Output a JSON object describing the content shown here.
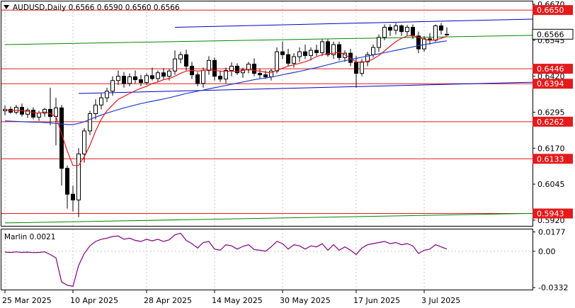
{
  "header": {
    "symbol_text": "AUDUSD,Daily  0.6566 0.6590 0.6560 0.6566"
  },
  "chart_data": {
    "type": "candlestick",
    "symbol": "AUDUSD",
    "timeframe": "Daily",
    "ohlc_header": {
      "open": 0.6566,
      "high": 0.659,
      "low": 0.656,
      "close": 0.6566
    },
    "y_range": [
      0.59,
      0.668
    ],
    "price_ticks": [
      "0.6670",
      "0.6545",
      "0.6420",
      "0.6295",
      "0.6170",
      "0.6045",
      "0.5920"
    ],
    "price_tick_values": [
      0.667,
      0.6545,
      0.642,
      0.6295,
      0.617,
      0.6045,
      0.592
    ],
    "date_labels": [
      "25 Mar 2025",
      "10 Apr 2025",
      "28 Apr 2025",
      "14 May 2025",
      "30 May 2025",
      "17 Jun 2025",
      "3 Jul 2025"
    ],
    "date_label_bar_index": [
      0,
      12,
      25,
      37,
      49,
      62,
      74
    ],
    "current_price": "0.6566",
    "horizontal_levels": [
      {
        "label": "0.6650",
        "value": 0.665,
        "color": "#e41a1c"
      },
      {
        "label": "0.6446",
        "value": 0.6446,
        "color": "#e41a1c"
      },
      {
        "label": "0.6394",
        "value": 0.6394,
        "color": "#e41a1c"
      },
      {
        "label": "0.6262",
        "value": 0.6262,
        "color": "#e41a1c"
      },
      {
        "label": "0.6133",
        "value": 0.6133,
        "color": "#e41a1c"
      },
      {
        "label": "0.5943",
        "value": 0.5943,
        "color": "#e41a1c"
      }
    ],
    "candles": [
      [
        0.63,
        0.6318,
        0.6285,
        0.6305
      ],
      [
        0.6305,
        0.6315,
        0.629,
        0.6295
      ],
      [
        0.6295,
        0.632,
        0.6288,
        0.6312
      ],
      [
        0.6312,
        0.6325,
        0.628,
        0.6288
      ],
      [
        0.6288,
        0.631,
        0.6275,
        0.6302
      ],
      [
        0.6302,
        0.6312,
        0.627,
        0.6278
      ],
      [
        0.6278,
        0.63,
        0.6265,
        0.6292
      ],
      [
        0.6292,
        0.631,
        0.628,
        0.6305
      ],
      [
        0.6305,
        0.638,
        0.625,
        0.628
      ],
      [
        0.628,
        0.6345,
        0.618,
        0.631
      ],
      [
        0.631,
        0.632,
        0.604,
        0.61
      ],
      [
        0.61,
        0.611,
        0.596,
        0.601
      ],
      [
        0.601,
        0.604,
        0.595,
        0.599
      ],
      [
        0.599,
        0.617,
        0.593,
        0.615
      ],
      [
        0.615,
        0.624,
        0.612,
        0.623
      ],
      [
        0.623,
        0.63,
        0.6215,
        0.629
      ],
      [
        0.629,
        0.634,
        0.627,
        0.632
      ],
      [
        0.632,
        0.636,
        0.6305,
        0.6345
      ],
      [
        0.6345,
        0.638,
        0.633,
        0.6368
      ],
      [
        0.6368,
        0.642,
        0.6352,
        0.6405
      ],
      [
        0.6405,
        0.644,
        0.639,
        0.642
      ],
      [
        0.642,
        0.6435,
        0.638,
        0.6395
      ],
      [
        0.6395,
        0.643,
        0.6385,
        0.6418
      ],
      [
        0.6418,
        0.644,
        0.6395,
        0.6408
      ],
      [
        0.6408,
        0.6425,
        0.6385,
        0.6398
      ],
      [
        0.6398,
        0.643,
        0.639,
        0.6422
      ],
      [
        0.6422,
        0.645,
        0.6405,
        0.6412
      ],
      [
        0.6412,
        0.644,
        0.64,
        0.6432
      ],
      [
        0.6432,
        0.6448,
        0.641,
        0.642
      ],
      [
        0.642,
        0.6445,
        0.6405,
        0.6438
      ],
      [
        0.6438,
        0.651,
        0.6425,
        0.648
      ],
      [
        0.648,
        0.6505,
        0.6465,
        0.6495
      ],
      [
        0.6495,
        0.6512,
        0.644,
        0.6455
      ],
      [
        0.6455,
        0.647,
        0.641,
        0.6425
      ],
      [
        0.6425,
        0.6435,
        0.6385,
        0.6395
      ],
      [
        0.6395,
        0.645,
        0.638,
        0.644
      ],
      [
        0.644,
        0.649,
        0.6425,
        0.6475
      ],
      [
        0.6475,
        0.6485,
        0.6405,
        0.642
      ],
      [
        0.642,
        0.644,
        0.64,
        0.641
      ],
      [
        0.641,
        0.645,
        0.6395,
        0.644
      ],
      [
        0.644,
        0.6468,
        0.642,
        0.6455
      ],
      [
        0.6455,
        0.6465,
        0.6425,
        0.6432
      ],
      [
        0.6432,
        0.645,
        0.6415,
        0.6442
      ],
      [
        0.6442,
        0.647,
        0.643,
        0.6462
      ],
      [
        0.6462,
        0.6482,
        0.642,
        0.643
      ],
      [
        0.643,
        0.6445,
        0.6412,
        0.6425
      ],
      [
        0.6425,
        0.644,
        0.641,
        0.6418
      ],
      [
        0.6418,
        0.6445,
        0.6405,
        0.6438
      ],
      [
        0.6438,
        0.652,
        0.643,
        0.6505
      ],
      [
        0.6505,
        0.654,
        0.648,
        0.6495
      ],
      [
        0.6495,
        0.6515,
        0.6455,
        0.6465
      ],
      [
        0.6465,
        0.65,
        0.645,
        0.6488
      ],
      [
        0.6488,
        0.652,
        0.647,
        0.6505
      ],
      [
        0.6505,
        0.653,
        0.648,
        0.6492
      ],
      [
        0.6492,
        0.652,
        0.6475,
        0.651
      ],
      [
        0.651,
        0.653,
        0.649,
        0.6502
      ],
      [
        0.6502,
        0.6548,
        0.649,
        0.654
      ],
      [
        0.654,
        0.6548,
        0.6488,
        0.6495
      ],
      [
        0.6495,
        0.654,
        0.648,
        0.653
      ],
      [
        0.653,
        0.654,
        0.6475,
        0.6485
      ],
      [
        0.6485,
        0.651,
        0.647,
        0.65
      ],
      [
        0.65,
        0.6515,
        0.6455,
        0.6468
      ],
      [
        0.6468,
        0.649,
        0.638,
        0.643
      ],
      [
        0.643,
        0.648,
        0.642,
        0.647
      ],
      [
        0.647,
        0.6505,
        0.6455,
        0.6495
      ],
      [
        0.6495,
        0.653,
        0.6485,
        0.652
      ],
      [
        0.652,
        0.6565,
        0.6505,
        0.6555
      ],
      [
        0.6555,
        0.66,
        0.6545,
        0.659
      ],
      [
        0.659,
        0.66,
        0.656,
        0.658
      ],
      [
        0.658,
        0.6605,
        0.6565,
        0.6595
      ],
      [
        0.6595,
        0.66,
        0.656,
        0.6575
      ],
      [
        0.6575,
        0.6598,
        0.656,
        0.659
      ],
      [
        0.659,
        0.66,
        0.655,
        0.656
      ],
      [
        0.656,
        0.6575,
        0.65,
        0.6515
      ],
      [
        0.6515,
        0.656,
        0.6505,
        0.655
      ],
      [
        0.655,
        0.657,
        0.653,
        0.6545
      ],
      [
        0.6545,
        0.66,
        0.654,
        0.6595
      ],
      [
        0.6595,
        0.6605,
        0.6565,
        0.658
      ],
      [
        0.6566,
        0.659,
        0.656,
        0.6566
      ]
    ],
    "sma_fast": [
      0.6305,
      0.63,
      0.6302,
      0.63,
      0.6298,
      0.6293,
      0.6292,
      0.6296,
      0.629,
      0.628,
      0.622,
      0.616,
      0.611,
      0.611,
      0.614,
      0.618,
      0.623,
      0.627,
      0.63,
      0.632,
      0.634,
      0.635,
      0.636,
      0.637,
      0.6378,
      0.6385,
      0.6395,
      0.64,
      0.6408,
      0.6412,
      0.642,
      0.643,
      0.6438,
      0.644,
      0.6438,
      0.644,
      0.6442,
      0.644,
      0.6438,
      0.6437,
      0.6438,
      0.6436,
      0.644,
      0.6444,
      0.644,
      0.6438,
      0.6434,
      0.6432,
      0.644,
      0.6448,
      0.6455,
      0.646,
      0.6465,
      0.647,
      0.6478,
      0.6488,
      0.6495,
      0.6498,
      0.65,
      0.6503,
      0.6495,
      0.6482,
      0.647,
      0.6468,
      0.6472,
      0.648,
      0.6492,
      0.6508,
      0.6525,
      0.654,
      0.6552,
      0.656,
      0.6562,
      0.6555,
      0.6548,
      0.6545,
      0.6546,
      0.6552,
      0.6558
    ],
    "sma_slow": [
      0.6265,
      0.6264,
      0.6263,
      0.6262,
      0.6261,
      0.626,
      0.626,
      0.6259,
      0.6258,
      0.6256,
      0.6254,
      0.6252,
      0.6252,
      0.6256,
      0.6262,
      0.627,
      0.6278,
      0.6285,
      0.6292,
      0.6298,
      0.6304,
      0.631,
      0.6315,
      0.632,
      0.6325,
      0.6329,
      0.6333,
      0.6337,
      0.6341,
      0.6345,
      0.635,
      0.6355,
      0.636,
      0.6364,
      0.6368,
      0.6372,
      0.6376,
      0.638,
      0.6384,
      0.6388,
      0.6392,
      0.6396,
      0.64,
      0.6404,
      0.6408,
      0.6411,
      0.6414,
      0.6417,
      0.6421,
      0.6425,
      0.6429,
      0.6433,
      0.6437,
      0.6441,
      0.6446,
      0.645,
      0.6455,
      0.646,
      0.6465,
      0.647,
      0.6474,
      0.6478,
      0.6482,
      0.6486,
      0.649,
      0.6494,
      0.6498,
      0.6502,
      0.6506,
      0.651,
      0.6514,
      0.6518,
      0.6522,
      0.6526,
      0.653,
      0.6533,
      0.6537,
      0.654,
      0.6543
    ],
    "trend_lines": [
      {
        "color": "#0000cc",
        "from": [
          30,
          0.659
        ],
        "to": [
          80,
          0.6612
        ]
      },
      {
        "color": "#0000cc",
        "from": [
          13,
          0.636
        ],
        "to": [
          80,
          0.6392
        ]
      },
      {
        "color": "#008800",
        "from": [
          0,
          0.653
        ],
        "to": [
          80,
          0.6557
        ]
      },
      {
        "color": "#008800",
        "from": [
          0,
          0.591
        ],
        "to": [
          80,
          0.5938
        ]
      }
    ],
    "marlin": {
      "label": "Marlin 0.0021",
      "ticks": [
        "0.0177",
        "0.00",
        "-0.0332"
      ],
      "tick_values": [
        0.0177,
        0.0,
        -0.0332
      ],
      "y_range": [
        -0.035,
        0.02
      ],
      "color": "#800080",
      "values": [
        -0.0008,
        -0.001,
        -0.0006,
        -0.001,
        -0.0008,
        -0.0012,
        -0.001,
        -0.0005,
        -0.003,
        -0.006,
        -0.028,
        -0.031,
        -0.032,
        -0.013,
        -0.002,
        0.005,
        0.009,
        0.011,
        0.012,
        0.0135,
        0.014,
        0.011,
        0.012,
        0.01,
        0.009,
        0.011,
        0.0095,
        0.011,
        0.009,
        0.0105,
        0.015,
        0.0165,
        0.01,
        0.007,
        0.003,
        0.008,
        0.009,
        0.002,
        0.001,
        0.006,
        0.005,
        0.002,
        0.0045,
        0.006,
        0.0015,
        0.001,
        0.0,
        0.004,
        0.009,
        0.007,
        0.002,
        0.006,
        0.005,
        0.002,
        0.005,
        0.004,
        0.007,
        0.001,
        0.006,
        0.001,
        0.004,
        0.001,
        -0.003,
        0.003,
        0.006,
        0.007,
        0.008,
        0.009,
        0.007,
        0.008,
        0.006,
        0.007,
        0.005,
        -0.002,
        0.001,
        0.002,
        0.006,
        0.004,
        0.0021
      ]
    }
  }
}
